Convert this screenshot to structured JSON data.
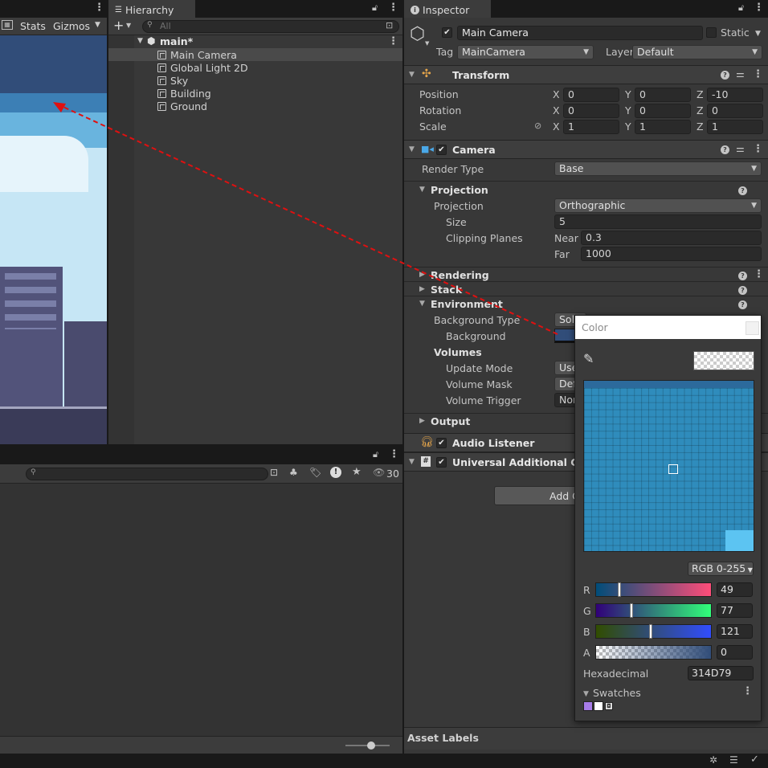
{
  "scene": {
    "stats_label": "Stats",
    "gizmos_label": "Gizmos"
  },
  "hierarchy": {
    "tab_label": "Hierarchy",
    "search_placeholder": "All",
    "scene_name": "main*",
    "items": [
      {
        "label": "Main Camera"
      },
      {
        "label": "Global Light 2D"
      },
      {
        "label": "Sky"
      },
      {
        "label": "Building"
      },
      {
        "label": "Ground"
      }
    ]
  },
  "project": {
    "count": "30"
  },
  "inspector": {
    "tab_label": "Inspector",
    "object_name": "Main Camera",
    "static_label": "Static",
    "tag_label": "Tag",
    "tag_value": "MainCamera",
    "layer_label": "Layer",
    "layer_value": "Default",
    "transform": {
      "title": "Transform",
      "position_label": "Position",
      "rotation_label": "Rotation",
      "scale_label": "Scale",
      "position": {
        "x": "0",
        "y": "0",
        "z": "-10"
      },
      "rotation": {
        "x": "0",
        "y": "0",
        "z": "0"
      },
      "scale": {
        "x": "1",
        "y": "1",
        "z": "1"
      },
      "axis_x": "X",
      "axis_y": "Y",
      "axis_z": "Z"
    },
    "camera": {
      "title": "Camera",
      "render_type_label": "Render Type",
      "render_type_value": "Base",
      "projection_section": "Projection",
      "projection_label": "Projection",
      "projection_value": "Orthographic",
      "size_label": "Size",
      "size_value": "5",
      "clipping_label": "Clipping Planes",
      "near_label": "Near",
      "near_value": "0.3",
      "far_label": "Far",
      "far_value": "1000",
      "rendering_section": "Rendering",
      "stack_section": "Stack",
      "environment_section": "Environment",
      "bg_type_label": "Background Type",
      "bg_type_value": "Soli",
      "background_label": "Background",
      "volumes_label": "Volumes",
      "update_mode_label": "Update Mode",
      "update_mode_value": "Use",
      "volume_mask_label": "Volume Mask",
      "volume_mask_value": "Def",
      "volume_trigger_label": "Volume Trigger",
      "volume_trigger_value": "Non",
      "output_section": "Output"
    },
    "audio_listener": {
      "title": "Audio Listener"
    },
    "universal": {
      "title": "Universal Additional Came"
    },
    "add_component_label": "Add C",
    "asset_labels": "Asset Labels"
  },
  "color_picker": {
    "title": "Color",
    "mode_label": "RGB 0-255",
    "r_label": "R",
    "r_value": "49",
    "g_label": "G",
    "g_value": "77",
    "b_label": "B",
    "b_value": "121",
    "a_label": "A",
    "a_value": "0",
    "hex_label": "Hexadecimal",
    "hex_value": "314D79",
    "swatches_label": "Swatches",
    "color_hex": "#314D79"
  }
}
